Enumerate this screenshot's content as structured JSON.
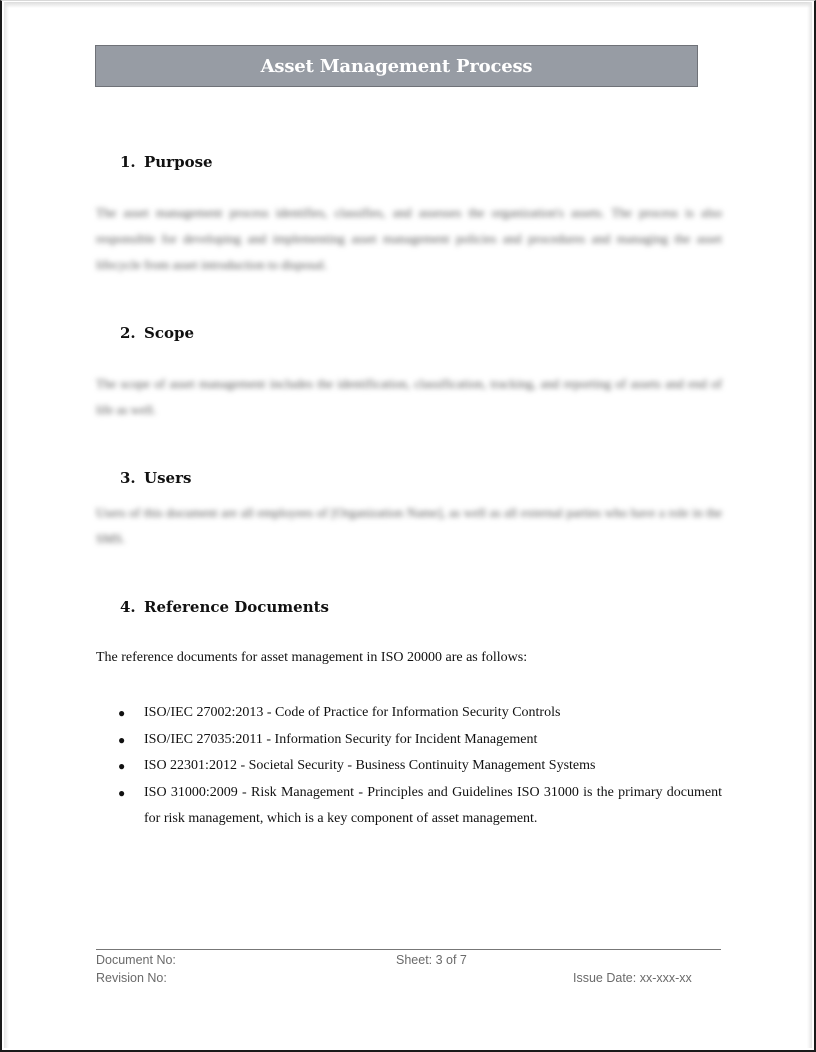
{
  "document": {
    "title": "Asset Management Process",
    "sections": [
      {
        "number": "1.",
        "heading": "Purpose",
        "body": "The asset management process identifies, classifies, and assesses the organization's assets. The process is also responsible for developing and implementing asset management policies and procedures and managing the asset lifecycle from asset introduction to disposal."
      },
      {
        "number": "2.",
        "heading": "Scope",
        "body": "The scope of asset management includes the identification, classification, tracking, and reporting of assets and end of life as well."
      },
      {
        "number": "3.",
        "heading": "Users",
        "body": "Users of this document are all employees of [Organization Name], as well as all external parties who have a role in the SMS."
      },
      {
        "number": "4.",
        "heading": "Reference Documents",
        "intro": "The reference documents for asset management in ISO 20000 are as follows:",
        "items": [
          "ISO/IEC 27002:2013 - Code of Practice for Information Security Controls",
          "ISO/IEC 27035:2011 - Information Security for Incident Management",
          "ISO 22301:2012 - Societal Security - Business Continuity Management Systems",
          "ISO 31000:2009 - Risk Management - Principles and Guidelines ISO 31000 is the primary document for risk management, which is a key component of asset management."
        ]
      }
    ]
  },
  "footer": {
    "document_no": "Document No:",
    "revision_no": "Revision No:",
    "sheet": "Sheet: 3 of 7",
    "issue_date": "Issue Date: xx-xxx-xx"
  },
  "colors": {
    "title_bar": "#979ca4",
    "footer_text": "#6a6a6a"
  }
}
